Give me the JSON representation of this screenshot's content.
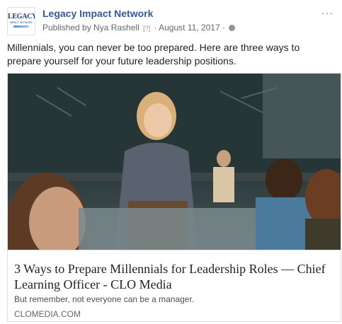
{
  "header": {
    "page_name": "Legacy Impact Network",
    "published_by": "Published by Nya Rashell",
    "help_marker": "[?]",
    "separator": "·",
    "date": "August 11, 2017",
    "avatar_logo_text": "LEGACY",
    "avatar_logo_subtext": "IMPACT NETWORK",
    "more_icon": "more-dots-icon",
    "audience_icon": "globe-icon"
  },
  "post": {
    "message": "Millennials, you can never be too prepared. Here are three ways to prepare yourself for your future leadership positions."
  },
  "link_preview": {
    "title": "3 Ways to Prepare Millennials for Leadership Roles — Chief Learning Officer - CLO Media",
    "description": "But remember, not everyone can be a manager.",
    "domain": "CLOMEDIA.COM"
  },
  "colors": {
    "link_blue": "#385898",
    "meta_gray": "#616770",
    "text_dark": "#1d2129",
    "border": "#dddfe2"
  }
}
